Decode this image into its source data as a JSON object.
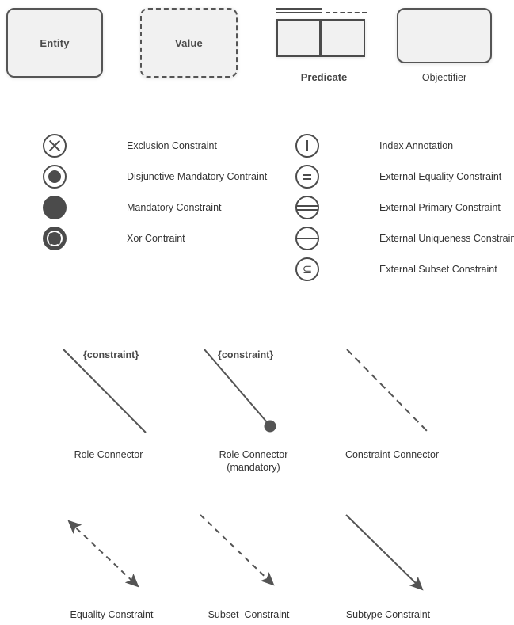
{
  "shapes": {
    "entity": {
      "label": "Entity"
    },
    "value": {
      "label": "Value"
    },
    "predicate": {
      "label": "Predicate"
    },
    "objectifier": {
      "label": "Objectifier"
    }
  },
  "constraints_left": [
    {
      "icon": "exclusion-constraint-icon",
      "label": "Exclusion Constraint"
    },
    {
      "icon": "disjunctive-mandatory-constraint-icon",
      "label": "Disjunctive Mandatory Contraint"
    },
    {
      "icon": "mandatory-constraint-icon",
      "label": "Mandatory Constraint"
    },
    {
      "icon": "xor-constraint-icon",
      "label": "Xor Contraint"
    }
  ],
  "constraints_right": [
    {
      "icon": "index-annotation-icon",
      "label": "Index Annotation"
    },
    {
      "icon": "external-equality-constraint-icon",
      "label": "External Equality Constraint"
    },
    {
      "icon": "external-primary-constraint-icon",
      "label": "External Primary Constraint"
    },
    {
      "icon": "external-uniqueness-constraint-icon",
      "label": "External Uniqueness Constraint"
    },
    {
      "icon": "external-subset-constraint-icon",
      "label": "External Subset Constraint"
    }
  ],
  "connectors_row1": [
    {
      "tag": "{constraint}",
      "label": "Role Connector"
    },
    {
      "tag": "{constraint}",
      "label": "Role Connector\n(mandatory)"
    },
    {
      "tag": "",
      "label": "Constraint Connector"
    }
  ],
  "connectors_row2": [
    {
      "label": "Equality Constraint"
    },
    {
      "label": "Subset  Constraint"
    },
    {
      "label": "Subtype Constraint"
    }
  ],
  "colors": {
    "stroke": "#4b4b4b",
    "fill": "#f1f1f1",
    "text": "#333333",
    "background": "#ffffff"
  }
}
